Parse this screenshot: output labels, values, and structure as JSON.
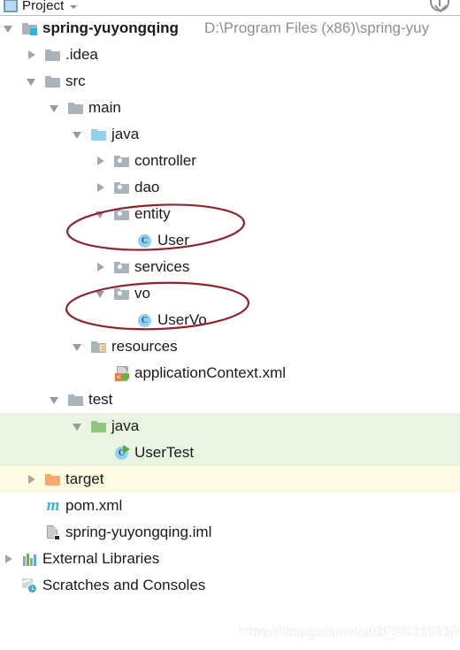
{
  "header": {
    "icon": "project-window-icon",
    "title": "Project",
    "chevron": "chevron-down-icon",
    "right_icon": "collapse-all-icon"
  },
  "tree": {
    "rows": [
      {
        "id": "spring-yuyongqing",
        "label": "spring-yuyongqing",
        "secondary": "D:\\Program Files (x86)\\spring-yuy",
        "depth": 0,
        "twisty": "expanded",
        "icon": "project-root-folder-icon",
        "bold": true
      },
      {
        "id": "idea",
        "label": ".idea",
        "secondary": "",
        "depth": 1,
        "twisty": "collapsed",
        "icon": "folder-icon",
        "bold": false
      },
      {
        "id": "src",
        "label": "src",
        "secondary": "",
        "depth": 1,
        "twisty": "expanded",
        "icon": "folder-icon",
        "bold": false
      },
      {
        "id": "main",
        "label": "main",
        "secondary": "",
        "depth": 2,
        "twisty": "expanded",
        "icon": "folder-icon",
        "bold": false
      },
      {
        "id": "java-main",
        "label": "java",
        "secondary": "",
        "depth": 3,
        "twisty": "expanded",
        "icon": "source-root-folder-icon",
        "bold": false
      },
      {
        "id": "controller",
        "label": "controller",
        "secondary": "",
        "depth": 4,
        "twisty": "collapsed",
        "icon": "package-folder-icon",
        "bold": false
      },
      {
        "id": "dao",
        "label": "dao",
        "secondary": "",
        "depth": 4,
        "twisty": "collapsed",
        "icon": "package-folder-icon",
        "bold": false
      },
      {
        "id": "entity",
        "label": "entity",
        "secondary": "",
        "depth": 4,
        "twisty": "expanded",
        "icon": "package-folder-icon",
        "bold": false
      },
      {
        "id": "User",
        "label": "User",
        "secondary": "",
        "depth": 5,
        "twisty": "none",
        "icon": "java-class-icon",
        "bold": false
      },
      {
        "id": "services",
        "label": "services",
        "secondary": "",
        "depth": 4,
        "twisty": "collapsed",
        "icon": "package-folder-icon",
        "bold": false
      },
      {
        "id": "vo",
        "label": "vo",
        "secondary": "",
        "depth": 4,
        "twisty": "expanded",
        "icon": "package-folder-icon",
        "bold": false
      },
      {
        "id": "UserVo",
        "label": "UserVo",
        "secondary": "",
        "depth": 5,
        "twisty": "none",
        "icon": "java-class-icon",
        "bold": false
      },
      {
        "id": "resources",
        "label": "resources",
        "secondary": "",
        "depth": 3,
        "twisty": "expanded",
        "icon": "resources-root-folder-icon",
        "bold": false
      },
      {
        "id": "applicationContext",
        "label": "applicationContext.xml",
        "secondary": "",
        "depth": 4,
        "twisty": "none",
        "icon": "spring-xml-file-icon",
        "bold": false
      },
      {
        "id": "test",
        "label": "test",
        "secondary": "",
        "depth": 2,
        "twisty": "expanded",
        "icon": "folder-icon",
        "bold": false
      },
      {
        "id": "java-test",
        "label": "java",
        "secondary": "",
        "depth": 3,
        "twisty": "expanded",
        "icon": "test-source-root-folder-icon",
        "bold": false
      },
      {
        "id": "UserTest",
        "label": "UserTest",
        "secondary": "",
        "depth": 4,
        "twisty": "none",
        "icon": "java-test-class-icon",
        "bold": false
      },
      {
        "id": "target",
        "label": "target",
        "secondary": "",
        "depth": 1,
        "twisty": "collapsed",
        "icon": "excluded-folder-icon",
        "bold": false
      },
      {
        "id": "pom",
        "label": "pom.xml",
        "secondary": "",
        "depth": 1,
        "twisty": "none",
        "icon": "maven-pom-icon",
        "bold": false
      },
      {
        "id": "iml",
        "label": "spring-yuyongqing.iml",
        "secondary": "",
        "depth": 1,
        "twisty": "none",
        "icon": "module-iml-file-icon",
        "bold": false
      },
      {
        "id": "external-libraries",
        "label": "External Libraries",
        "secondary": "",
        "depth": 0,
        "twisty": "collapsed",
        "icon": "external-libraries-icon",
        "bold": false
      },
      {
        "id": "scratches",
        "label": "Scratches and Consoles",
        "secondary": "",
        "depth": 0,
        "twisty": "none",
        "icon": "scratches-icon",
        "bold": false
      }
    ]
  },
  "annotations": {
    "ellipses": [
      {
        "id": "entity-user-ellipse",
        "label": "red-ellipse-around-entity-and-User"
      },
      {
        "id": "vo-uservo-ellipse",
        "label": "red-ellipse-around-vo-and-UserVo"
      }
    ],
    "stroke_color": "#8c2530"
  },
  "highlights": {
    "test_source_band_color": "#e9f5e0",
    "excluded_band_color": "#fcfae0"
  },
  "watermark": {
    "line_a": "https://blog.csdn.net/u010561259317",
    "line_b": "https://blog.csdn.net/u0_56-12593j7"
  }
}
